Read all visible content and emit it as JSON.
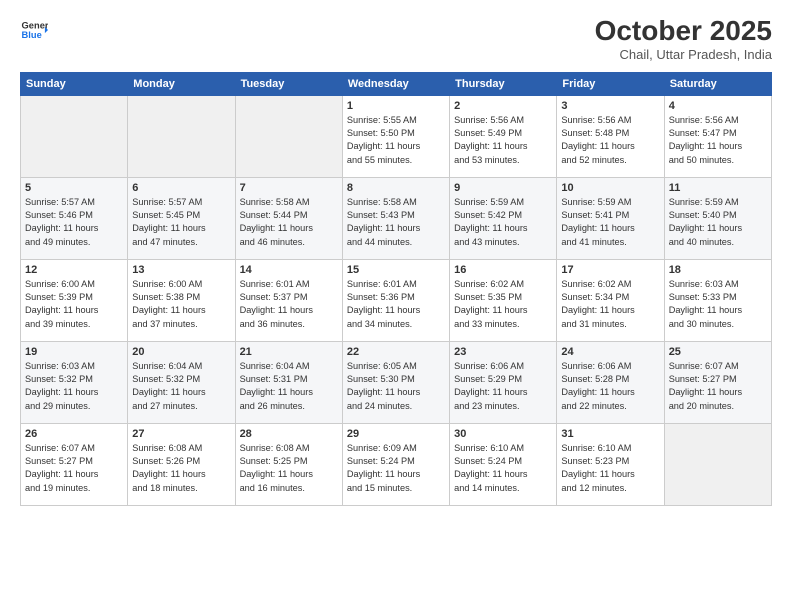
{
  "logo": {
    "line1": "General",
    "line2": "Blue",
    "arrow_color": "#1a73e8"
  },
  "title": "October 2025",
  "subtitle": "Chail, Uttar Pradesh, India",
  "days_of_week": [
    "Sunday",
    "Monday",
    "Tuesday",
    "Wednesday",
    "Thursday",
    "Friday",
    "Saturday"
  ],
  "weeks": [
    [
      {
        "day": "",
        "info": ""
      },
      {
        "day": "",
        "info": ""
      },
      {
        "day": "",
        "info": ""
      },
      {
        "day": "1",
        "info": "Sunrise: 5:55 AM\nSunset: 5:50 PM\nDaylight: 11 hours\nand 55 minutes."
      },
      {
        "day": "2",
        "info": "Sunrise: 5:56 AM\nSunset: 5:49 PM\nDaylight: 11 hours\nand 53 minutes."
      },
      {
        "day": "3",
        "info": "Sunrise: 5:56 AM\nSunset: 5:48 PM\nDaylight: 11 hours\nand 52 minutes."
      },
      {
        "day": "4",
        "info": "Sunrise: 5:56 AM\nSunset: 5:47 PM\nDaylight: 11 hours\nand 50 minutes."
      }
    ],
    [
      {
        "day": "5",
        "info": "Sunrise: 5:57 AM\nSunset: 5:46 PM\nDaylight: 11 hours\nand 49 minutes."
      },
      {
        "day": "6",
        "info": "Sunrise: 5:57 AM\nSunset: 5:45 PM\nDaylight: 11 hours\nand 47 minutes."
      },
      {
        "day": "7",
        "info": "Sunrise: 5:58 AM\nSunset: 5:44 PM\nDaylight: 11 hours\nand 46 minutes."
      },
      {
        "day": "8",
        "info": "Sunrise: 5:58 AM\nSunset: 5:43 PM\nDaylight: 11 hours\nand 44 minutes."
      },
      {
        "day": "9",
        "info": "Sunrise: 5:59 AM\nSunset: 5:42 PM\nDaylight: 11 hours\nand 43 minutes."
      },
      {
        "day": "10",
        "info": "Sunrise: 5:59 AM\nSunset: 5:41 PM\nDaylight: 11 hours\nand 41 minutes."
      },
      {
        "day": "11",
        "info": "Sunrise: 5:59 AM\nSunset: 5:40 PM\nDaylight: 11 hours\nand 40 minutes."
      }
    ],
    [
      {
        "day": "12",
        "info": "Sunrise: 6:00 AM\nSunset: 5:39 PM\nDaylight: 11 hours\nand 39 minutes."
      },
      {
        "day": "13",
        "info": "Sunrise: 6:00 AM\nSunset: 5:38 PM\nDaylight: 11 hours\nand 37 minutes."
      },
      {
        "day": "14",
        "info": "Sunrise: 6:01 AM\nSunset: 5:37 PM\nDaylight: 11 hours\nand 36 minutes."
      },
      {
        "day": "15",
        "info": "Sunrise: 6:01 AM\nSunset: 5:36 PM\nDaylight: 11 hours\nand 34 minutes."
      },
      {
        "day": "16",
        "info": "Sunrise: 6:02 AM\nSunset: 5:35 PM\nDaylight: 11 hours\nand 33 minutes."
      },
      {
        "day": "17",
        "info": "Sunrise: 6:02 AM\nSunset: 5:34 PM\nDaylight: 11 hours\nand 31 minutes."
      },
      {
        "day": "18",
        "info": "Sunrise: 6:03 AM\nSunset: 5:33 PM\nDaylight: 11 hours\nand 30 minutes."
      }
    ],
    [
      {
        "day": "19",
        "info": "Sunrise: 6:03 AM\nSunset: 5:32 PM\nDaylight: 11 hours\nand 29 minutes."
      },
      {
        "day": "20",
        "info": "Sunrise: 6:04 AM\nSunset: 5:32 PM\nDaylight: 11 hours\nand 27 minutes."
      },
      {
        "day": "21",
        "info": "Sunrise: 6:04 AM\nSunset: 5:31 PM\nDaylight: 11 hours\nand 26 minutes."
      },
      {
        "day": "22",
        "info": "Sunrise: 6:05 AM\nSunset: 5:30 PM\nDaylight: 11 hours\nand 24 minutes."
      },
      {
        "day": "23",
        "info": "Sunrise: 6:06 AM\nSunset: 5:29 PM\nDaylight: 11 hours\nand 23 minutes."
      },
      {
        "day": "24",
        "info": "Sunrise: 6:06 AM\nSunset: 5:28 PM\nDaylight: 11 hours\nand 22 minutes."
      },
      {
        "day": "25",
        "info": "Sunrise: 6:07 AM\nSunset: 5:27 PM\nDaylight: 11 hours\nand 20 minutes."
      }
    ],
    [
      {
        "day": "26",
        "info": "Sunrise: 6:07 AM\nSunset: 5:27 PM\nDaylight: 11 hours\nand 19 minutes."
      },
      {
        "day": "27",
        "info": "Sunrise: 6:08 AM\nSunset: 5:26 PM\nDaylight: 11 hours\nand 18 minutes."
      },
      {
        "day": "28",
        "info": "Sunrise: 6:08 AM\nSunset: 5:25 PM\nDaylight: 11 hours\nand 16 minutes."
      },
      {
        "day": "29",
        "info": "Sunrise: 6:09 AM\nSunset: 5:24 PM\nDaylight: 11 hours\nand 15 minutes."
      },
      {
        "day": "30",
        "info": "Sunrise: 6:10 AM\nSunset: 5:24 PM\nDaylight: 11 hours\nand 14 minutes."
      },
      {
        "day": "31",
        "info": "Sunrise: 6:10 AM\nSunset: 5:23 PM\nDaylight: 11 hours\nand 12 minutes."
      },
      {
        "day": "",
        "info": ""
      }
    ]
  ]
}
